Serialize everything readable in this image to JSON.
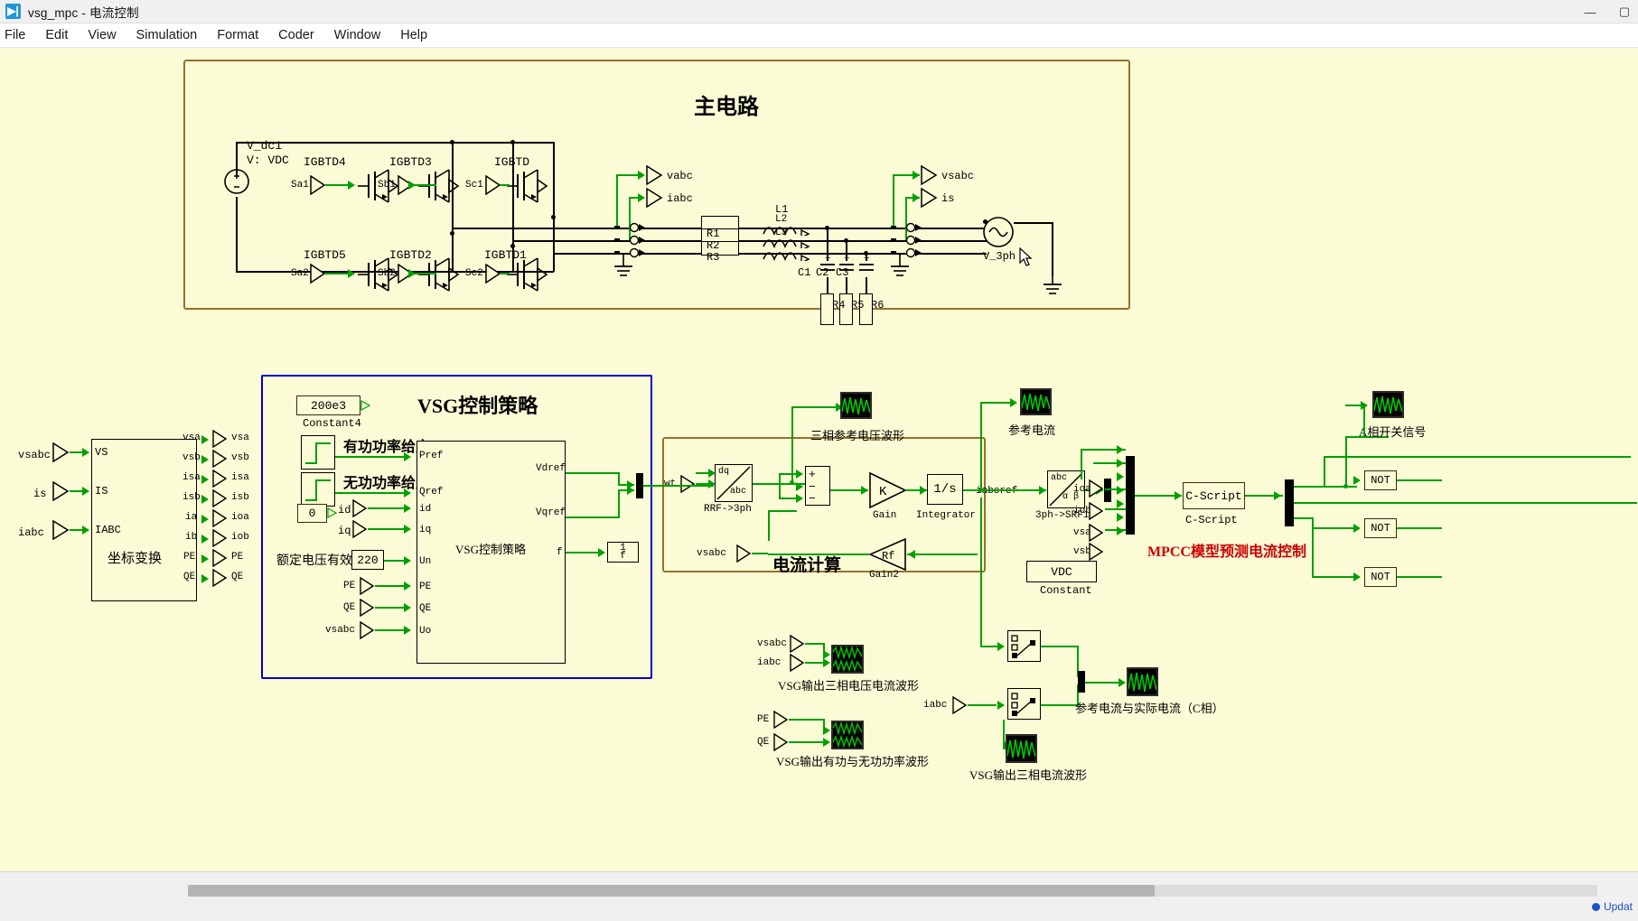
{
  "window": {
    "title": "vsg_mpc - 电流控制",
    "icon": "simulation-app-icon",
    "minimize": "—",
    "maximize": "▢",
    "close": "✕"
  },
  "menubar": {
    "items": [
      "File",
      "Edit",
      "View",
      "Simulation",
      "Format",
      "Coder",
      "Window",
      "Help"
    ]
  },
  "main_circuit": {
    "title": "主电路",
    "dc_source": {
      "label1": "V_dc1",
      "label2": "V: VDC"
    },
    "igbts": [
      {
        "name": "IGBTD4",
        "gate": "Sa1"
      },
      {
        "name": "IGBTD3",
        "gate": "Sb1"
      },
      {
        "name": "IGBTD",
        "gate": "Sc1"
      },
      {
        "name": "IGBTD5",
        "gate": "Sa2"
      },
      {
        "name": "IGBTD2",
        "gate": "Sb2"
      },
      {
        "name": "IGBTD1",
        "gate": "Sc2"
      }
    ],
    "gate_mid_labels": [
      "Sb1",
      "Sc1",
      "Sb2",
      "Sc2"
    ],
    "probes_left": [
      "vabc",
      "iabc"
    ],
    "probes_right": [
      "vsabc",
      "is"
    ],
    "resistors": [
      "R1",
      "R2",
      "R3"
    ],
    "inductors": [
      "L1",
      "L2",
      "L3"
    ],
    "capacitors": [
      "C1",
      "C2",
      "C3"
    ],
    "damping_resistors": [
      "R4",
      "R5",
      "R6"
    ],
    "ac_source": "V_3ph"
  },
  "coord_transform": {
    "block_label": "坐标变换",
    "inputs": [
      "vsabc",
      "is",
      "iabc"
    ],
    "input_ports": [
      "VS",
      "IS",
      "IABC"
    ],
    "output_ports": [
      "vsa",
      "vsb",
      "isa",
      "isb",
      "ia",
      "ib",
      "PE",
      "QE"
    ],
    "output_labels": [
      "vsa",
      "vsb",
      "isa",
      "isb",
      "ioa",
      "iob",
      "PE",
      "QE"
    ]
  },
  "vsg_panel": {
    "title": "VSG控制策略",
    "constant4": {
      "value": "200e3",
      "name": "Constant4"
    },
    "step_p_label": "有功功率给定",
    "step_q_label": "无功功率给定",
    "zero_const": "0",
    "id_label": "id",
    "iq_label": "iq",
    "un_label": "额定电压有效值",
    "un_value": "220",
    "pe_label": "PE",
    "qe_label": "QE",
    "vsabc_label": "vsabc",
    "block": {
      "name": "VSG控制策略",
      "inputs": [
        "Pref",
        "Qref",
        "id",
        "iq",
        "Un",
        "PE",
        "QE",
        "Uo"
      ],
      "outputs": [
        "Vdref",
        "Vqref",
        "f"
      ]
    },
    "freq_display": "1\nf",
    "freq_num": "1",
    "freq_den": "f"
  },
  "current_calc": {
    "title": "电流计算",
    "wt_label": "wt",
    "dq_abc": {
      "top": "dq",
      "bottom": "abc",
      "name": "RRF->3ph"
    },
    "sum_signs": [
      "+",
      "−",
      "−"
    ],
    "gain": {
      "symbol": "K",
      "name": "Gain"
    },
    "integrator": {
      "symbol": "1/s",
      "name": "Integrator"
    },
    "gain2": {
      "symbol": "Rf",
      "name": "Gain2"
    },
    "vsabc_label": "vsabc",
    "iabcref_label": "iabcref"
  },
  "mpcc": {
    "abc_ab": {
      "top": "abc",
      "bottom": "α β",
      "name": "3ph->SRF1"
    },
    "port_labels": [
      "ioa",
      "iob",
      "vsa",
      "vsb"
    ],
    "vdc_const": {
      "value": "VDC",
      "name": "Constant"
    },
    "cscript": {
      "label": "C-Script",
      "name": "C-Script"
    },
    "title": "MPCC模型预测电流控制",
    "not_gates": [
      "NOT",
      "NOT",
      "NOT"
    ]
  },
  "scopes": [
    {
      "id": "scope-ref-voltage",
      "label": "三相参考电压波形"
    },
    {
      "id": "scope-ref-current",
      "label": "参考电流"
    },
    {
      "id": "scope-phase-a-switch",
      "label": "A相开关信号"
    },
    {
      "id": "scope-vsg-vi",
      "label": "VSG输出三相电压电流波形",
      "inputs": [
        "vsabc",
        "iabc"
      ]
    },
    {
      "id": "scope-vsg-pq",
      "label": "VSG输出有功与无功功率波形",
      "inputs": [
        "PE",
        "QE"
      ]
    },
    {
      "id": "scope-ref-vs-actual",
      "label": "参考电流与实际电流（C相）"
    },
    {
      "id": "scope-vsg-current",
      "label": "VSG输出三相电流波形",
      "inputs": [
        "iabc"
      ]
    }
  ],
  "statusbar": {
    "message": "Updat",
    "indicator": "status-indicator"
  },
  "colors": {
    "canvas": "#fbfbd6",
    "wire": "#00a000",
    "group_border": "#96712b",
    "vsg_border": "#0000cc",
    "accent_red": "#cc0000",
    "scope_bg": "#000000",
    "scope_trace": "#00c800"
  }
}
